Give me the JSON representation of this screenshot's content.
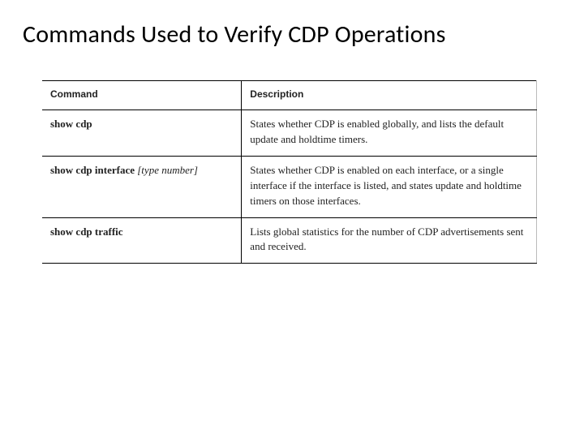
{
  "title": "Commands Used to Verify CDP Operations",
  "table": {
    "headers": {
      "command": "Command",
      "description": "Description"
    },
    "rows": [
      {
        "command_main": "show cdp",
        "command_arg": "",
        "description": "States whether CDP is enabled globally, and lists the default update and holdtime timers."
      },
      {
        "command_main": "show cdp interface",
        "command_arg": " [type number]",
        "description": "States whether CDP is enabled on each interface, or a single interface if the interface is listed, and states update and holdtime timers on those interfaces."
      },
      {
        "command_main": "show cdp traffic",
        "command_arg": "",
        "description": "Lists global statistics for the number of CDP advertisements sent and received."
      }
    ]
  }
}
